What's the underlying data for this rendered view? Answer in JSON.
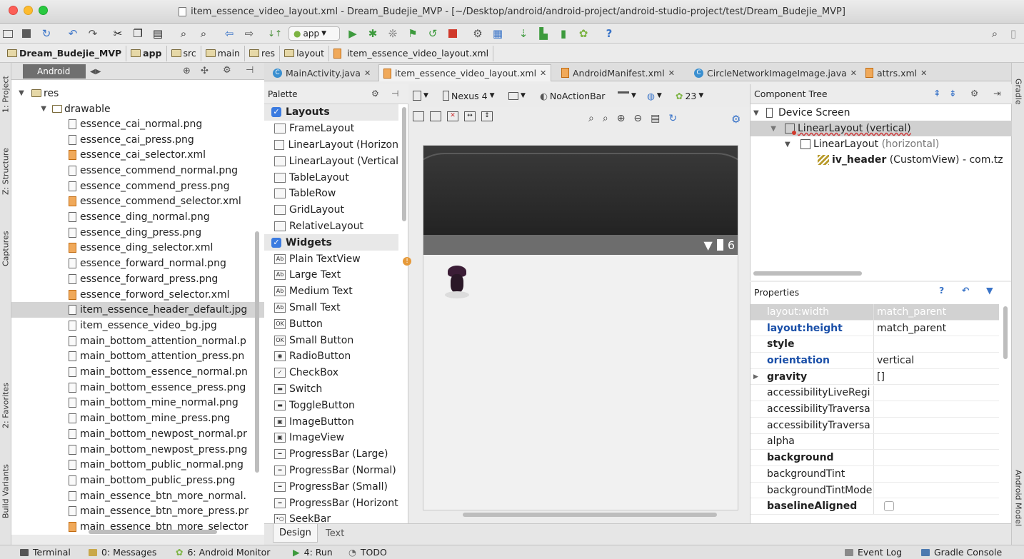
{
  "window": {
    "title": "item_essence_video_layout.xml - Dream_Budejie_MVP - [~/Desktop/android/android-project/android-studio-project/test/Dream_Budejie_MVP]"
  },
  "toolbar": {
    "run_config": "app",
    "help": "?"
  },
  "breadcrumbs": [
    "Dream_Budejie_MVP",
    "app",
    "src",
    "main",
    "res",
    "layout",
    "item_essence_video_layout.xml"
  ],
  "left_strip": {
    "project": "1: Project",
    "structure": "Z: Structure",
    "captures": "Captures",
    "favorites": "2: Favorites",
    "build_variants": "Build Variants"
  },
  "right_strip": {
    "gradle": "Gradle",
    "android_model": "Android Model"
  },
  "project_panel": {
    "view": "Android",
    "nodes": [
      "res",
      "drawable"
    ],
    "files": [
      {
        "name": "essence_cai_normal.png",
        "type": "png"
      },
      {
        "name": "essence_cai_press.png",
        "type": "png"
      },
      {
        "name": "essence_cai_selector.xml",
        "type": "xml"
      },
      {
        "name": "essence_commend_normal.png",
        "type": "png"
      },
      {
        "name": "essence_commend_press.png",
        "type": "png"
      },
      {
        "name": "essence_commend_selector.xml",
        "type": "xml"
      },
      {
        "name": "essence_ding_normal.png",
        "type": "png"
      },
      {
        "name": "essence_ding_press.png",
        "type": "png"
      },
      {
        "name": "essence_ding_selector.xml",
        "type": "xml"
      },
      {
        "name": "essence_forward_normal.png",
        "type": "png"
      },
      {
        "name": "essence_forward_press.png",
        "type": "png"
      },
      {
        "name": "essence_forword_selector.xml",
        "type": "xml"
      },
      {
        "name": "item_essence_header_default.jpg",
        "type": "png",
        "selected": true
      },
      {
        "name": "item_essence_video_bg.jpg",
        "type": "png"
      },
      {
        "name": "main_bottom_attention_normal.p",
        "type": "png"
      },
      {
        "name": "main_bottom_attention_press.pn",
        "type": "png"
      },
      {
        "name": "main_bottom_essence_normal.pn",
        "type": "png"
      },
      {
        "name": "main_bottom_essence_press.png",
        "type": "png"
      },
      {
        "name": "main_bottom_mine_normal.png",
        "type": "png"
      },
      {
        "name": "main_bottom_mine_press.png",
        "type": "png"
      },
      {
        "name": "main_bottom_newpost_normal.pr",
        "type": "png"
      },
      {
        "name": "main_bottom_newpost_press.png",
        "type": "png"
      },
      {
        "name": "main_bottom_public_normal.png",
        "type": "png"
      },
      {
        "name": "main_bottom_public_press.png",
        "type": "png"
      },
      {
        "name": "main_essence_btn_more_normal.",
        "type": "png"
      },
      {
        "name": "main_essence_btn_more_press.pr",
        "type": "png"
      },
      {
        "name": "main_essence_btn_more_selector",
        "type": "xml"
      }
    ]
  },
  "editor_tabs": [
    {
      "label": "MainActivity.java",
      "active": false
    },
    {
      "label": "item_essence_video_layout.xml",
      "active": true
    },
    {
      "label": "AndroidManifest.xml",
      "active": false
    },
    {
      "label": "CircleNetworkImageImage.java",
      "active": false
    },
    {
      "label": "attrs.xml",
      "active": false
    }
  ],
  "palette": {
    "title": "Palette",
    "items": [
      {
        "label": "Layouts",
        "group": true
      },
      {
        "label": "FrameLayout",
        "icon": ""
      },
      {
        "label": "LinearLayout (Horizon",
        "icon": ""
      },
      {
        "label": "LinearLayout (Vertical",
        "icon": ""
      },
      {
        "label": "TableLayout",
        "icon": ""
      },
      {
        "label": "TableRow",
        "icon": ""
      },
      {
        "label": "GridLayout",
        "icon": ""
      },
      {
        "label": "RelativeLayout",
        "icon": ""
      },
      {
        "label": "Widgets",
        "group": true
      },
      {
        "label": "Plain TextView",
        "icon": "Ab"
      },
      {
        "label": "Large Text",
        "icon": "Ab"
      },
      {
        "label": "Medium Text",
        "icon": "Ab"
      },
      {
        "label": "Small Text",
        "icon": "Ab"
      },
      {
        "label": "Button",
        "icon": "OK"
      },
      {
        "label": "Small Button",
        "icon": "OK"
      },
      {
        "label": "RadioButton",
        "icon": "◉"
      },
      {
        "label": "CheckBox",
        "icon": "✓"
      },
      {
        "label": "Switch",
        "icon": "▬"
      },
      {
        "label": "ToggleButton",
        "icon": "▬"
      },
      {
        "label": "ImageButton",
        "icon": "▣"
      },
      {
        "label": "ImageView",
        "icon": "▣"
      },
      {
        "label": "ProgressBar (Large)",
        "icon": "━"
      },
      {
        "label": "ProgressBar (Normal)",
        "icon": "━"
      },
      {
        "label": "ProgressBar (Small)",
        "icon": "━"
      },
      {
        "label": "ProgressBar (Horizont",
        "icon": "━"
      },
      {
        "label": "SeekBar",
        "icon": "•○"
      }
    ]
  },
  "designer": {
    "device": "Nexus 4",
    "theme": "NoActionBar",
    "api": "23",
    "status_right": "6"
  },
  "component_tree": {
    "title": "Component Tree",
    "rows": [
      {
        "label": "Device Screen",
        "secondary": "",
        "bold": false
      },
      {
        "label": "LinearLayout (vertical)",
        "secondary": "",
        "bold": false,
        "selected": true
      },
      {
        "label": "LinearLayout",
        "secondary": "(horizontal)",
        "bold": false
      },
      {
        "label": "iv_header",
        "secondary": "(CustomView) - com.tz",
        "bold": true
      }
    ]
  },
  "properties": {
    "title": "Properties",
    "rows": [
      {
        "name": "layout:width",
        "value": "match_parent",
        "style": "highlight"
      },
      {
        "name": "layout:height",
        "value": "match_parent",
        "style": "blue"
      },
      {
        "name": "style",
        "value": "",
        "style": "bold"
      },
      {
        "name": "orientation",
        "value": "vertical",
        "style": "blue"
      },
      {
        "name": "gravity",
        "value": "[]",
        "style": "bold",
        "expand": true
      },
      {
        "name": "accessibilityLiveRegi",
        "value": "",
        "style": "normal"
      },
      {
        "name": "accessibilityTraversa",
        "value": "",
        "style": "normal"
      },
      {
        "name": "accessibilityTraversa",
        "value": "",
        "style": "normal"
      },
      {
        "name": "alpha",
        "value": "",
        "style": "normal"
      },
      {
        "name": "background",
        "value": "",
        "style": "bold"
      },
      {
        "name": "backgroundTint",
        "value": "",
        "style": "normal"
      },
      {
        "name": "backgroundTintMode",
        "value": "",
        "style": "normal"
      },
      {
        "name": "baselineAligned",
        "value": "",
        "style": "bold",
        "checkbox": true
      }
    ]
  },
  "design_tabs": [
    "Design",
    "Text"
  ],
  "bottom_bar": {
    "left": [
      "Terminal",
      "0: Messages",
      "6: Android Monitor",
      "4: Run",
      "TODO"
    ],
    "right": [
      "Event Log",
      "Gradle Console"
    ]
  },
  "colors": {
    "accent_blue": "#1a4fa8",
    "selection": "#d4d4d4",
    "xml_icon": "#f0a95a"
  }
}
